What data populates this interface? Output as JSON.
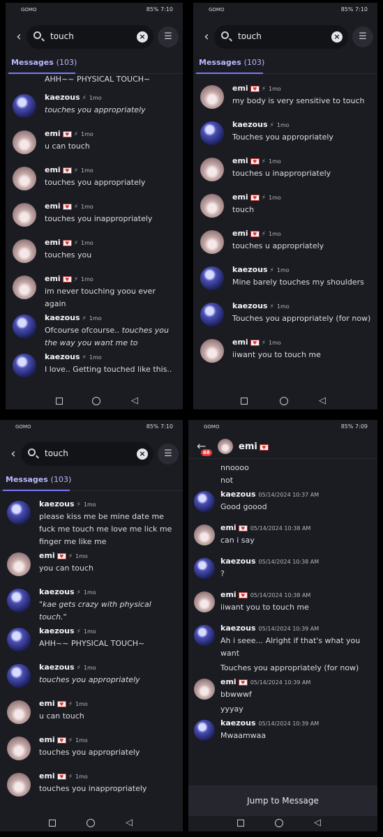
{
  "status": {
    "carrier": "GOMO",
    "battery": "85%",
    "time_a": "7:10",
    "time_b": "7:09"
  },
  "search": {
    "query": "touch",
    "clear_icon": "close-icon",
    "filter_icon": "sliders-icon"
  },
  "tab": {
    "label": "Messages",
    "count": "(103)"
  },
  "panel1": [
    {
      "text": "AHH~~ PHYSICAL TOUCH~"
    },
    {
      "user": "kaezous",
      "time": "1mo",
      "text": "touches you appropriately",
      "italic": true
    },
    {
      "user": "emi",
      "time": "1mo",
      "text": "u can touch"
    },
    {
      "user": "emi",
      "time": "1mo",
      "text": "touches you appropriately"
    },
    {
      "user": "emi",
      "time": "1mo",
      "text": "touches you inappropriately"
    },
    {
      "user": "emi",
      "time": "1mo",
      "text": "touches you"
    },
    {
      "user": "emi",
      "time": "1mo",
      "text": "im never touching yoou ever again"
    },
    {
      "user": "kaezous",
      "time": "1mo",
      "text_plain": "Ofcourse ofcourse.. ",
      "text_italic": "touches you the way you want me to"
    },
    {
      "user": "kaezous",
      "time": "1mo",
      "text": "I love.. Getting touched like this.."
    }
  ],
  "panel2": [
    {
      "user": "emi",
      "time": "1mo",
      "text": "my body is very sensitive to touch"
    },
    {
      "user": "kaezous",
      "time": "1mo",
      "text": "Touches you appropriately"
    },
    {
      "user": "emi",
      "time": "1mo",
      "text": "touches u inappropriately"
    },
    {
      "user": "emi",
      "time": "1mo",
      "text": "touch"
    },
    {
      "user": "emi",
      "time": "1mo",
      "text": "touches u appropriately"
    },
    {
      "user": "kaezous",
      "time": "1mo",
      "text": "Mine barely touches my shoulders"
    },
    {
      "user": "kaezous",
      "time": "1mo",
      "text": "Touches you appropriately (for now)"
    },
    {
      "user": "emi",
      "time": "1mo",
      "text": "iiwant you to touch me"
    }
  ],
  "panel3": [
    {
      "user": "kaezous",
      "time": "1mo",
      "text": "please kiss me be mine date me fuck me touch me love me lick me finger me like me"
    },
    {
      "user": "emi",
      "time": "1mo",
      "text": "you can touch"
    },
    {
      "user": "kaezous",
      "time": "1mo",
      "text": "\"kae gets crazy with physical touch.\"",
      "italic": true
    },
    {
      "user": "kaezous",
      "time": "1mo",
      "text": "AHH~~ PHYSICAL TOUCH~"
    },
    {
      "user": "kaezous",
      "time": "1mo",
      "text": "touches you appropriately",
      "italic": true
    },
    {
      "user": "emi",
      "time": "1mo",
      "text": "u can touch"
    },
    {
      "user": "emi",
      "time": "1mo",
      "text": "touches you appropriately"
    },
    {
      "user": "emi",
      "time": "1mo",
      "text": "touches you inappropriately"
    }
  ],
  "dm": {
    "name": "emi",
    "unread": "68",
    "top_lines": [
      "nnoooo",
      "not"
    ],
    "messages": [
      {
        "user": "kaezous",
        "time": "05/14/2024 10:37 AM",
        "lines": [
          "Good goood"
        ]
      },
      {
        "user": "emi",
        "time": "05/14/2024 10:38 AM",
        "lines": [
          "can i say"
        ]
      },
      {
        "user": "kaezous",
        "time": "05/14/2024 10:38 AM",
        "lines": [
          "?"
        ]
      },
      {
        "user": "emi",
        "time": "05/14/2024 10:38 AM",
        "lines": [
          "iiwant you to touch me"
        ]
      },
      {
        "user": "kaezous",
        "time": "05/14/2024 10:39 AM",
        "lines": [
          "Ah i seee... Alright if that's what you want",
          "Touches you appropriately (for now)"
        ]
      },
      {
        "user": "emi",
        "time": "05/14/2024 10:39 AM",
        "lines": [
          "bbwwwf",
          "yyyay"
        ]
      },
      {
        "user": "kaezous",
        "time": "05/14/2024 10:39 AM",
        "lines": [
          "Mwaamwaa"
        ]
      }
    ],
    "jump_label": "Jump to Message"
  }
}
